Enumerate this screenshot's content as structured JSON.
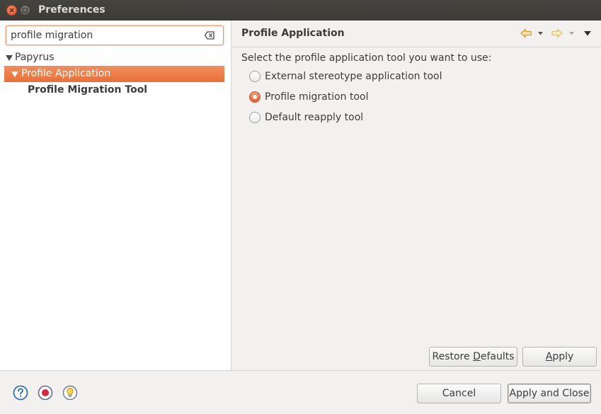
{
  "window": {
    "title": "Preferences"
  },
  "search": {
    "value": "profile migration"
  },
  "tree": {
    "items": [
      {
        "label": "Papyrus"
      },
      {
        "label": "Profile Application"
      },
      {
        "label": "Profile Migration Tool"
      }
    ]
  },
  "page": {
    "title": "Profile Application",
    "prompt": "Select the profile application tool you want to use:",
    "options": [
      {
        "label": "External stereotype application tool",
        "checked": false
      },
      {
        "label": "Profile migration tool",
        "checked": true
      },
      {
        "label": "Default reapply tool",
        "checked": false
      }
    ],
    "restore_defaults_pre": "Restore ",
    "restore_defaults_mnemonic": "D",
    "restore_defaults_post": "efaults",
    "apply_mnemonic": "A",
    "apply_post": "pply"
  },
  "footer": {
    "cancel_label": "Cancel",
    "apply_close_label": "Apply and Close"
  },
  "icons": {
    "close": "close-icon",
    "maximize": "maximize-icon",
    "clear": "clear-search-icon",
    "back": "back-arrow-icon",
    "forward": "forward-arrow-icon",
    "menu": "view-menu-icon",
    "help": "help-icon",
    "record": "record-macro-icon",
    "tip": "lightbulb-icon"
  },
  "colors": {
    "accent": "#e96f37",
    "nav_arrow": "#e8a83a"
  }
}
